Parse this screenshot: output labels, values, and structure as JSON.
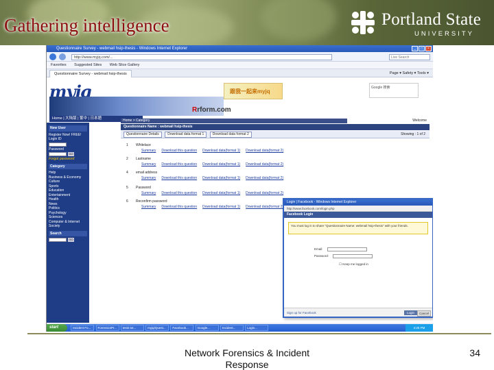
{
  "slide": {
    "title": "Gathering intelligence",
    "footer_line1": "Network Forensics & Incident",
    "footer_line2": "Response",
    "page_number": "34",
    "logo": {
      "name": "Portland State",
      "sub": "UNIVERSITY"
    }
  },
  "browser": {
    "window_title": "Questionnaire Survey - webmail hsip-thesis - Windows Internet Explorer",
    "address": "http://www.myjq.com/...",
    "search_placeholder": "Live Search",
    "links": [
      "Favorites",
      "Suggested Sites",
      "Web Slice Gallery"
    ],
    "tab_label": "Questionnaire Survey - webmail hsip-thesis",
    "tools": "Page ▾  Safety ▾  Tools ▾"
  },
  "site": {
    "logo": "myjq",
    "ad_text": "跟我一起来myjq",
    "rform": "rform.com",
    "rform_prefix": "R",
    "search_text": "Google 搜索",
    "nav": "Home | 大陆版 | 繁中 | 日本語",
    "sidebar": {
      "new_user": "New User",
      "register": "Register Now! FREE!",
      "login_id": "Login ID",
      "password": "Password",
      "forgot": "Forgot password",
      "category_title": "Category",
      "categories": [
        "Help",
        "Business & Economy",
        "Culture",
        "Sports",
        "Education",
        "Entertainment",
        "Health",
        "News",
        "Politics",
        "Psychology",
        "Sciences",
        "Computer & Internet",
        "Society"
      ],
      "search_title": "Search",
      "go": "GO"
    },
    "breadcrumb": "Home > Category",
    "welcome": "Welcome",
    "questionnaire_name": "Questionnaire Name : webmail hsip-thesis",
    "toolbar_buttons": [
      "Questionnaire Details",
      "Download data format 1",
      "Download data format 2"
    ],
    "showing": "Showing : 1 of 2",
    "questions": [
      {
        "num": "1",
        "label": "Whitelace"
      },
      {
        "num": "2",
        "label": "Lastname"
      },
      {
        "num": "3",
        "label": ""
      },
      {
        "num": "4",
        "label": "email address"
      },
      {
        "num": "5",
        "label": "Password"
      },
      {
        "num": "6",
        "label": "Reconfirm password"
      }
    ],
    "question_links": [
      "Summary",
      "Download this question",
      "Download data(format 1)",
      "Download data(format 2)"
    ]
  },
  "popup": {
    "title": "Login | Facebook - Windows Internet Explorer",
    "url": "http://www.facebook.com/login.php",
    "brand": "Facebook Login",
    "notice": "You must log in to share \"Questionnaire Name: webmail hsip-thesis\" with your friends.",
    "email_label": "Email:",
    "password_label": "Password:",
    "keep_logged": "Keep me logged in",
    "signup": "Sign up for Facebook",
    "login_btn": "Login",
    "cancel_btn": "Cancel"
  },
  "taskbar": {
    "start": "start",
    "items": [
      "Incident Fo...",
      "ForensicsPr...",
      "test2.txt...",
      "myjq/Quest...",
      "Facebook...",
      "Google...",
      "Incident...",
      "Login..."
    ],
    "clock": "4:25 PM"
  }
}
